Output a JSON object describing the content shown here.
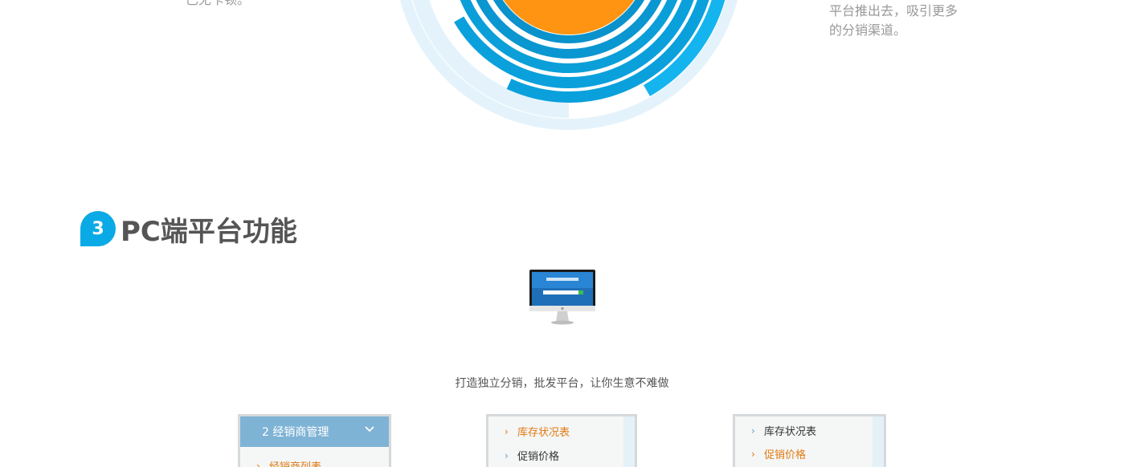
{
  "top_left_fragment": "已无卡顿。",
  "top_right_desc": {
    "line1": "平台推出去，吸引更多",
    "line2": "的分销渠道。"
  },
  "colors": {
    "accent_blue": "#0aaae6",
    "orange_core": "#ff9412",
    "ring_dark": "#0aa0dc",
    "ring_light": "#e4f3fb",
    "panel_header": "#7fb3d6",
    "menu_active": "#e07a12"
  },
  "section": {
    "number": "3",
    "title": "PC端平台功能",
    "tagline": "打造独立分销，批发平台，让你生意不难做"
  },
  "panels": [
    {
      "header": "2 经销商管理",
      "header_icon": "chevron-down-icon",
      "items": [
        {
          "label": "经销商列表",
          "active": true
        }
      ]
    },
    {
      "items": [
        {
          "label": "库存状况表",
          "active": true
        },
        {
          "label": "促销价格",
          "active": false
        }
      ]
    },
    {
      "items": [
        {
          "label": "库存状况表",
          "active": false
        },
        {
          "label": "促销价格",
          "active": true
        }
      ]
    }
  ]
}
